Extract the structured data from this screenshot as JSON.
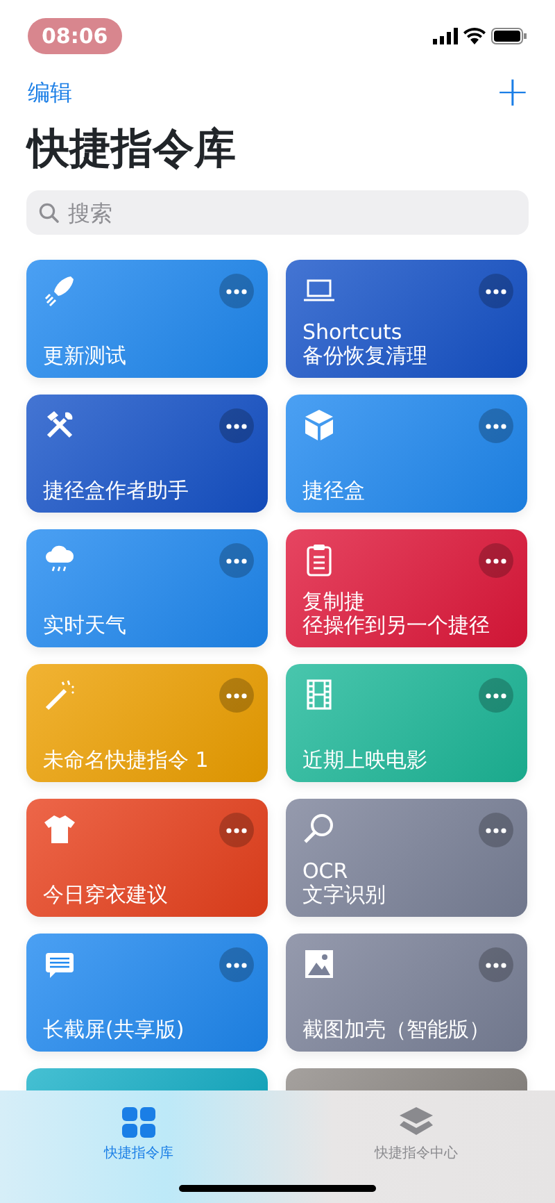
{
  "status_bar": {
    "time": "08:06",
    "recording": true
  },
  "nav": {
    "edit": "编辑",
    "add": "+"
  },
  "title": "快捷指令库",
  "search": {
    "placeholder": "搜索"
  },
  "card_rows": [
    {
      "cards": [
        {
          "title_lines": [
            "更新测试"
          ],
          "color": "#1e88f0"
        },
        {
          "title_lines": [
            "Shortcuts",
            "备份恢复清理"
          ],
          "color": "#1552c8"
        }
      ]
    },
    {
      "cards": [
        {
          "title_lines": [
            "捷径盒作者助手"
          ],
          "color": "#1552c8"
        },
        {
          "title_lines": [
            "捷径盒"
          ],
          "color": "#1e88f0"
        }
      ]
    },
    {
      "cards": [
        {
          "title_lines": [
            "实时天气"
          ],
          "color": "#1e88f0"
        },
        {
          "title_lines": [
            "复制捷",
            "径操作到另一个捷径"
          ],
          "color": "#e0173a"
        }
      ]
    },
    {
      "cards": [
        {
          "title_lines": [
            "未命名快捷指令 1"
          ],
          "color": "#eea000"
        },
        {
          "title_lines": [
            "近期上映电影"
          ],
          "color": "#1cb898"
        }
      ]
    },
    {
      "cards": [
        {
          "title_lines": [
            "今日穿衣建议"
          ],
          "color": "#e8401c"
        },
        {
          "title_lines": [
            "OCR",
            "文字识别"
          ],
          "color": "#7a8198"
        }
      ]
    },
    {
      "cards": [
        {
          "title_lines": [
            "长截屏(共享版)"
          ],
          "color": "#1e88f0"
        },
        {
          "title_lines": [
            "截图加壳（智能版）"
          ],
          "color": "#7a8198"
        }
      ]
    },
    {
      "cards": [
        {
          "color": "#18b0c8"
        },
        {
          "color": "#8e8a86"
        }
      ]
    }
  ],
  "tabs": [
    {
      "label": "快捷指令库",
      "selected": true
    },
    {
      "label": "快捷指令中心",
      "selected": false
    }
  ]
}
